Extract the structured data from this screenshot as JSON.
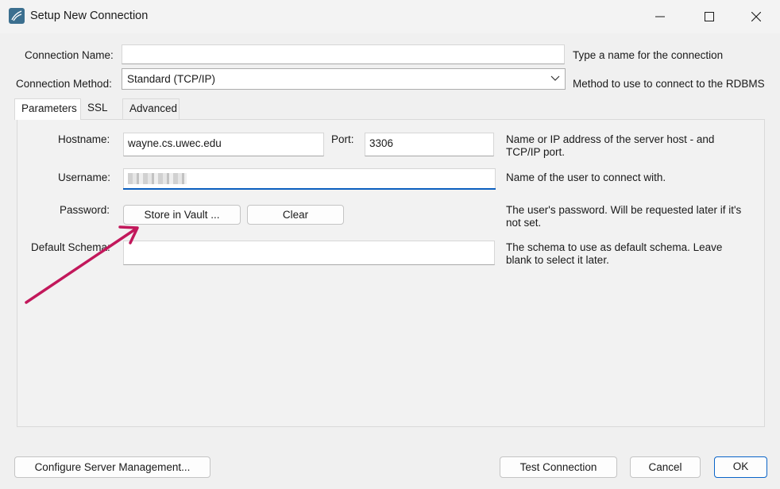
{
  "window": {
    "title": "Setup New Connection",
    "app_icon": "mysql-workbench-icon",
    "controls": [
      "minimize-icon",
      "maximize-icon",
      "close-icon"
    ]
  },
  "form": {
    "connection_name": {
      "label": "Connection Name:",
      "value": "",
      "help": "Type a name for the connection"
    },
    "connection_method": {
      "label": "Connection Method:",
      "value": "Standard (TCP/IP)",
      "help": "Method to use to connect to the RDBMS"
    }
  },
  "tabs": [
    {
      "label": "Parameters",
      "active": true
    },
    {
      "label": "SSL",
      "active": false
    },
    {
      "label": "Advanced",
      "active": false
    }
  ],
  "parameters": {
    "hostname": {
      "label": "Hostname:",
      "value": "wayne.cs.uwec.edu",
      "help_line1": "Name or IP address of the server host - and",
      "help_line2": "TCP/IP port."
    },
    "port": {
      "label": "Port:",
      "value": "3306"
    },
    "username": {
      "label": "Username:",
      "help": "Name of the user to connect with."
    },
    "password": {
      "label": "Password:",
      "store_button": "Store in Vault ...",
      "clear_button": "Clear",
      "help_line1": "The user's password. Will be requested later if it's",
      "help_line2": "not set."
    },
    "default_schema": {
      "label": "Default Schema:",
      "value": "",
      "help_line1": "The schema to use as default schema. Leave",
      "help_line2": "blank to select it later."
    }
  },
  "footer": {
    "configure_button": "Configure Server Management...",
    "test_button": "Test Connection",
    "cancel_button": "Cancel",
    "ok_button": "OK"
  },
  "annotation": {
    "arrow_color": "#c2185b"
  },
  "colors": {
    "accent": "#0b5fbf",
    "dialog_bg": "#f0f0f0",
    "field_bg": "#ffffff"
  }
}
